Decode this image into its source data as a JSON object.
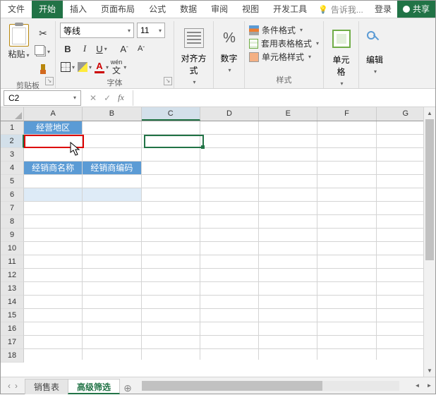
{
  "tabs": {
    "file": "文件",
    "home": "开始",
    "insert": "插入",
    "layout": "页面布局",
    "formula": "公式",
    "data": "数据",
    "review": "审阅",
    "view": "视图",
    "dev": "开发工具"
  },
  "tellme": "告诉我...",
  "login": "登录",
  "share": "共享",
  "clipboard": {
    "paste": "粘贴",
    "group": "剪贴板"
  },
  "font": {
    "name": "等线",
    "size": "11",
    "group": "字体",
    "B": "B",
    "I": "I",
    "U": "U",
    "A": "A",
    "wen_top": "wén",
    "wen_bot": "文"
  },
  "align": {
    "label": "对齐方式"
  },
  "number": {
    "label": "数字",
    "sym": "%"
  },
  "styles": {
    "cond": "条件格式",
    "tblfmt": "套用表格格式",
    "cellfmt": "单元格样式",
    "group": "样式"
  },
  "cells": {
    "label": "单元格"
  },
  "editing": {
    "label": "编辑"
  },
  "namebox": "C2",
  "fx": "fx",
  "cols": [
    "A",
    "B",
    "C",
    "D",
    "E",
    "F",
    "G"
  ],
  "rows": [
    "1",
    "2",
    "3",
    "4",
    "5",
    "6",
    "7",
    "8",
    "9",
    "10",
    "11",
    "12",
    "13",
    "14",
    "15",
    "16",
    "17",
    "18"
  ],
  "celldata": {
    "A1": "经营地区",
    "A4": "经销商名称",
    "B4": "经销商编码"
  },
  "sheets": {
    "s1": "销售表",
    "s2": "高级筛选"
  },
  "nav": {
    "first": "◄",
    "prev": "‹",
    "next": "›",
    "last": "►"
  },
  "chart_data": null
}
